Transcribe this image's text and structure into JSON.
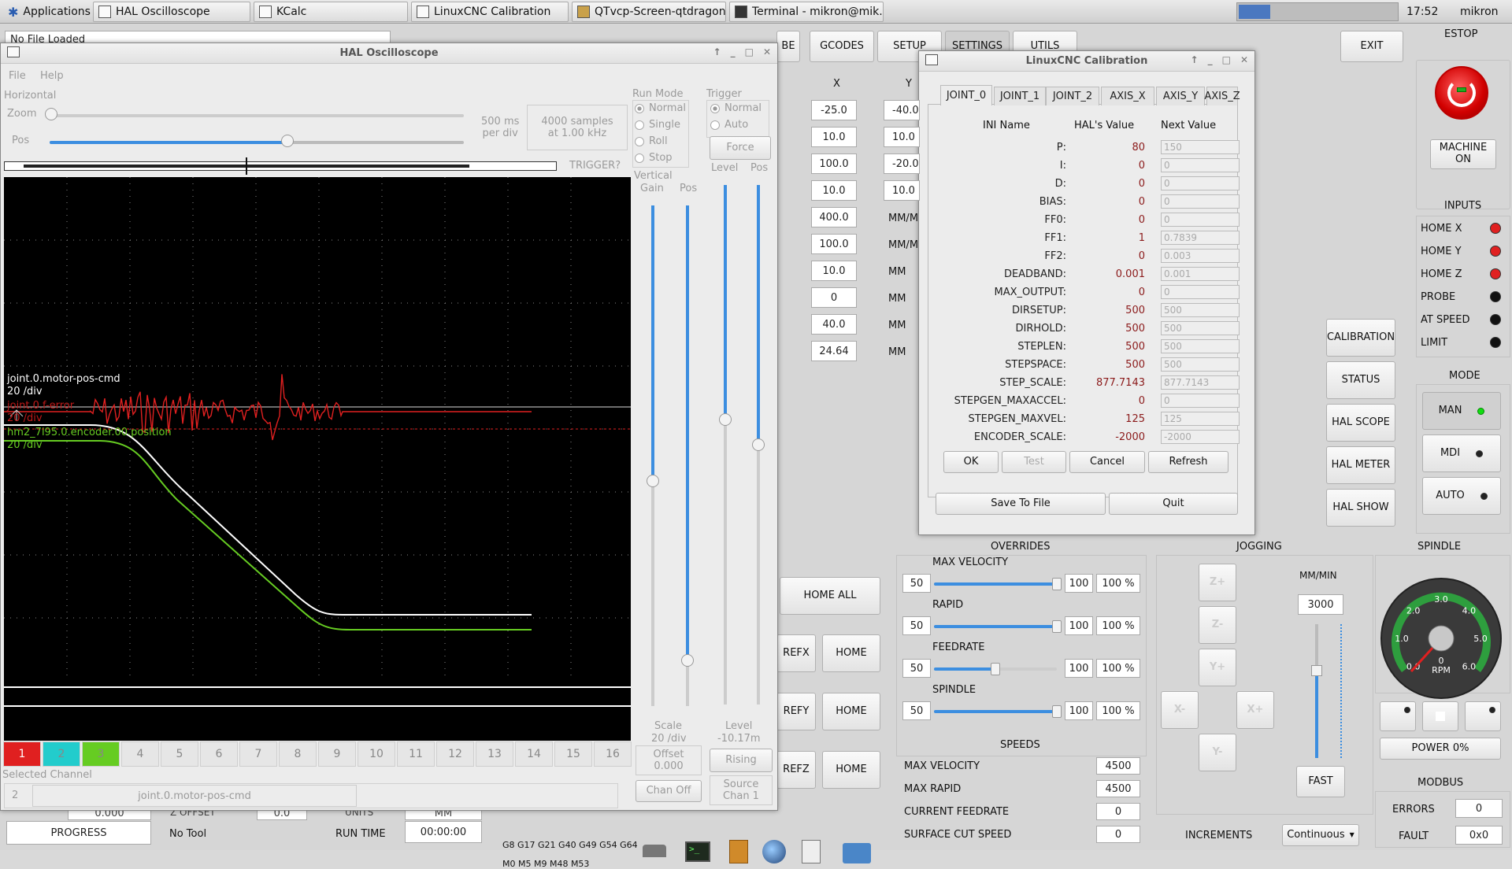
{
  "taskbar": {
    "apps_label": "Applications",
    "tasks": [
      "HAL Oscilloscope",
      "KCalc",
      "LinuxCNC Calibration",
      "QTvcp-Screen-qtdragon...",
      "Terminal - mikron@mik..."
    ],
    "clock": "17:52",
    "user": "mikron"
  },
  "qtdragon": {
    "file_combo": "No File Loaded",
    "tabs": [
      "GCODES",
      "SETUP",
      "SETTINGS",
      "UTILS"
    ],
    "tab_partial": "BE",
    "exit": "EXIT",
    "estop_label": "ESTOP",
    "machine_on": "MACHINE ON",
    "inputs_title": "INPUTS",
    "inputs": [
      "HOME X",
      "HOME Y",
      "HOME Z",
      "PROBE",
      "AT SPEED",
      "LIMIT"
    ],
    "mode_title": "MODE",
    "modes": [
      "MAN",
      "MDI",
      "AUTO"
    ],
    "col_x": "X",
    "col_y": "Y",
    "x_values": [
      "-25.0",
      "10.0",
      "100.0",
      "10.0",
      "400.0",
      "100.0",
      "10.0",
      "0",
      "40.0",
      "24.64"
    ],
    "y_values": [
      "-40.0",
      "10.0",
      "-20.0",
      "10.0"
    ],
    "unit_labels": [
      "MM/M",
      "MM/M",
      "MM",
      "MM",
      "MM",
      "MM"
    ],
    "side_buttons": [
      "CALIBRATION",
      "STATUS",
      "HAL SCOPE",
      "HAL METER",
      "HAL SHOW"
    ],
    "home_all": "HOME ALL",
    "ref_labels": [
      "REFX",
      "REFY",
      "REFZ"
    ],
    "home": "HOME",
    "overrides_title": "OVERRIDES",
    "overrides": [
      {
        "label": "MAX VELOCITY",
        "min": "50",
        "max": "100",
        "pct": "100 %",
        "value": 1.0
      },
      {
        "label": "RAPID",
        "min": "50",
        "max": "100",
        "pct": "100 %",
        "value": 1.0
      },
      {
        "label": "FEEDRATE",
        "min": "50",
        "max": "100",
        "pct": "100 %",
        "value": 0.5
      },
      {
        "label": "SPINDLE",
        "min": "50",
        "max": "100",
        "pct": "100 %",
        "value": 1.0
      }
    ],
    "speeds_title": "SPEEDS",
    "speeds": [
      {
        "label": "MAX VELOCITY",
        "value": "4500"
      },
      {
        "label": "MAX RAPID",
        "value": "4500"
      },
      {
        "label": "CURRENT FEEDRATE",
        "value": "0"
      },
      {
        "label": "SURFACE CUT SPEED",
        "value": "0"
      }
    ],
    "jogging_title": "JOGGING",
    "jog_units": "MM/MIN",
    "jog_rate": "3000",
    "jog_fast": "FAST",
    "jog_buttons": [
      "Z+",
      "Z-",
      "Y+",
      "X-",
      "X+",
      "Y-"
    ],
    "increments_label": "INCREMENTS",
    "increments_value": "Continuous",
    "spindle_title": "SPINDLE",
    "gauge_ticks": [
      "0.0",
      "1.0",
      "2.0",
      "3.0",
      "4.0",
      "5.0",
      "6.0"
    ],
    "gauge_unit": "RPM",
    "gauge_value": "0",
    "power": "POWER 0%",
    "modbus_title": "MODBUS",
    "errors_label": "ERRORS",
    "errors_value": "0",
    "fault_label": "FAULT",
    "fault_value": "0x0",
    "progress": "PROGRESS",
    "no_tool": "No Tool",
    "run_time_label": "RUN TIME",
    "run_time": "00:00:00",
    "gcodes_line1": "G8 G17 G21 G40 G49 G54 G64",
    "gcodes_line2": "M0 M5 M9 M48 M53",
    "partial_bottom": [
      "0.000",
      "Z OFFSET",
      "0.0",
      "UNITS",
      "MM"
    ]
  },
  "scope": {
    "title": "HAL Oscilloscope",
    "menu": [
      "File",
      "Help"
    ],
    "horizontal": "Horizontal",
    "zoom": "Zoom",
    "pos": "Pos",
    "rate": "500 ms\nper div",
    "samples": "4000 samples\nat 1.00 kHz",
    "trigger_q": "TRIGGER?",
    "run_mode_title": "Run Mode",
    "run_modes": [
      "Normal",
      "Single",
      "Roll",
      "Stop"
    ],
    "trigger_title": "Trigger",
    "trigger_modes": [
      "Normal",
      "Auto"
    ],
    "force": "Force",
    "vertical_title": "Vertical",
    "gain": "Gain",
    "vpos": "Pos",
    "level": "Level",
    "tpos": "Pos",
    "scale_label": "Scale",
    "scale_value": "20 /div",
    "offset_label": "Offset",
    "offset_value": "0.000",
    "chan_off": "Chan Off",
    "level_label": "Level",
    "level_value": "-10.17m",
    "rising": "Rising",
    "source_label": "Source",
    "source_value": "Chan  1",
    "channels": [
      "1",
      "2",
      "3",
      "4",
      "5",
      "6",
      "7",
      "8",
      "9",
      "10",
      "11",
      "12",
      "13",
      "14",
      "15",
      "16"
    ],
    "selected_channel_label": "Selected Channel",
    "selected_channel_num": "2",
    "selected_channel_name": "joint.0.motor-pos-cmd",
    "traces": [
      {
        "name": "joint.0.motor-pos-cmd",
        "scale": "20 /div",
        "color": "#ffffff"
      },
      {
        "name": "joint.0.f-error",
        "scale": "20 /div",
        "color": "#e02020"
      },
      {
        "name": "hm2_7i95.0.encoder.00.position",
        "scale": "20 /div",
        "color": "#66cc22"
      }
    ]
  },
  "calib": {
    "title": "LinuxCNC Calibration",
    "tabs": [
      "JOINT_0",
      "JOINT_1",
      "JOINT_2",
      "AXIS_X",
      "AXIS_Y",
      "AXIS_Z"
    ],
    "col_name": "INI Name",
    "col_hal": "HAL's Value",
    "col_next": "Next Value",
    "rows": [
      {
        "name": "P:",
        "hal": "80",
        "next": "150"
      },
      {
        "name": "I:",
        "hal": "0",
        "next": "0"
      },
      {
        "name": "D:",
        "hal": "0",
        "next": "0"
      },
      {
        "name": "BIAS:",
        "hal": "0",
        "next": "0"
      },
      {
        "name": "FF0:",
        "hal": "0",
        "next": "0"
      },
      {
        "name": "FF1:",
        "hal": "1",
        "next": "0.7839"
      },
      {
        "name": "FF2:",
        "hal": "0",
        "next": "0.003"
      },
      {
        "name": "DEADBAND:",
        "hal": "0.001",
        "next": "0.001"
      },
      {
        "name": "MAX_OUTPUT:",
        "hal": "0",
        "next": "0"
      },
      {
        "name": "DIRSETUP:",
        "hal": "500",
        "next": "500"
      },
      {
        "name": "DIRHOLD:",
        "hal": "500",
        "next": "500"
      },
      {
        "name": "STEPLEN:",
        "hal": "500",
        "next": "500"
      },
      {
        "name": "STEPSPACE:",
        "hal": "500",
        "next": "500"
      },
      {
        "name": "STEP_SCALE:",
        "hal": "877.7143",
        "next": "877.7143"
      },
      {
        "name": "STEPGEN_MAXACCEL:",
        "hal": "0",
        "next": "0"
      },
      {
        "name": "STEPGEN_MAXVEL:",
        "hal": "125",
        "next": "125"
      },
      {
        "name": "ENCODER_SCALE:",
        "hal": "-2000",
        "next": "-2000"
      }
    ],
    "ok": "OK",
    "test": "Test",
    "cancel": "Cancel",
    "refresh": "Refresh",
    "save": "Save To File",
    "quit": "Quit"
  }
}
